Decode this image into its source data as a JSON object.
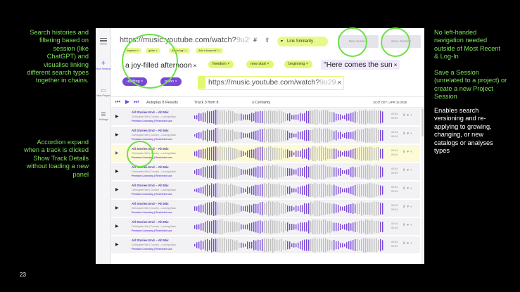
{
  "notes": {
    "left_1": "Search histories and filtering based on session (like ChatGPT) and visualise linking different search types together in chains.",
    "left_2": "Accordion expand when a track is clicked Show Track Details without loading a new panel",
    "right_1": "No left-handed navigation needed outside of Most Recent & Log-In",
    "right_2": "Save a Session (unrelated to a project) or create a new Project Session",
    "right_3": "Enables search versioning and re-applying to growing, changing, or new catalogs or analyses types"
  },
  "page_number": "23",
  "rail": {
    "items": [
      {
        "label": "New Session",
        "icon": "plus-icon"
      },
      {
        "label": "New Project",
        "icon": "folder-icon"
      },
      {
        "label": "Settings",
        "icon": "sliders-icon"
      }
    ]
  },
  "topbar": {
    "url_visible": "https://music.youtube.com/watch?",
    "url_faded": "9u29...",
    "link_similarity": "Link Similarity",
    "new_session": "New Session",
    "save_session": "Save Session"
  },
  "chips_small": [
    "Inspired ×",
    "guitar ×",
    "Add a tag? ×",
    "Add a keyword? ×"
  ],
  "query_text": "a joy-filled afternoon",
  "chips_yellow": [
    "freedom ×",
    "new start ×",
    "beginning ×"
  ],
  "query_quote": "\"Here comes the sun",
  "chips_purple": [
    "uplifting ×",
    "piano ×"
  ],
  "url_box": {
    "visible": "https://music.youtube.com/watch?",
    "faded": "9u29..."
  },
  "player": {
    "autoplay": "Autoplay 8 Results",
    "track": "Track 3 from 8",
    "sort": "Certainty",
    "timestamp": "18:47 CET | APR 15 2025"
  },
  "tracks": [
    {
      "title": "All Stories End – Alt Mix",
      "artist": "Christopher Bell | Country – Looking Back",
      "license": "Premium Licensing | Restricted use",
      "dur1": "00:04",
      "dur2": "00:04",
      "active": false
    },
    {
      "title": "All Stories End – Alt Mix",
      "artist": "Christopher Bell | Country – Looking Back",
      "license": "Premium Licensing | Restricted use",
      "dur1": "00:04",
      "dur2": "00:04",
      "active": false
    },
    {
      "title": "All Stories End – Alt Mix",
      "artist": "Christopher Bell | Country – Looking Back",
      "license": "Premium Licensing | Restricted use",
      "dur1": "00:04",
      "dur2": "00:04",
      "active": true
    },
    {
      "title": "All Stories End – Alt Mix",
      "artist": "Christopher Bell | Country – Looking Back",
      "license": "Premium Licensing | Restricted use",
      "dur1": "00:04",
      "dur2": "00:04",
      "active": false
    },
    {
      "title": "All Stories End – Alt Mix",
      "artist": "Christopher Bell | Country – Looking Back",
      "license": "Premium Licensing | Restricted use",
      "dur1": "00:04",
      "dur2": "00:04",
      "active": false
    },
    {
      "title": "All Stories End – Alt Mix",
      "artist": "Christopher Bell | Country – Looking Back",
      "license": "Premium Licensing | Restricted use",
      "dur1": "00:04",
      "dur2": "00:04",
      "active": false
    },
    {
      "title": "All Stories End – Alt Mix",
      "artist": "Christopher Bell | Country – Looking Back",
      "license": "Premium Licensing | Restricted use",
      "dur1": "00:04",
      "dur2": "00:04",
      "active": false
    },
    {
      "title": "All Stories End – Alt Mix",
      "artist": "Christopher Bell | Country – Looking Back",
      "license": "Premium Licensing | Restricted use",
      "dur1": "00:04",
      "dur2": "00:04",
      "active": false
    }
  ],
  "colors": {
    "accent_purple": "#7747d8",
    "accent_yellow": "#e3f86e",
    "annotation_green": "#7ee05a",
    "active_row": "#fdfad6"
  }
}
